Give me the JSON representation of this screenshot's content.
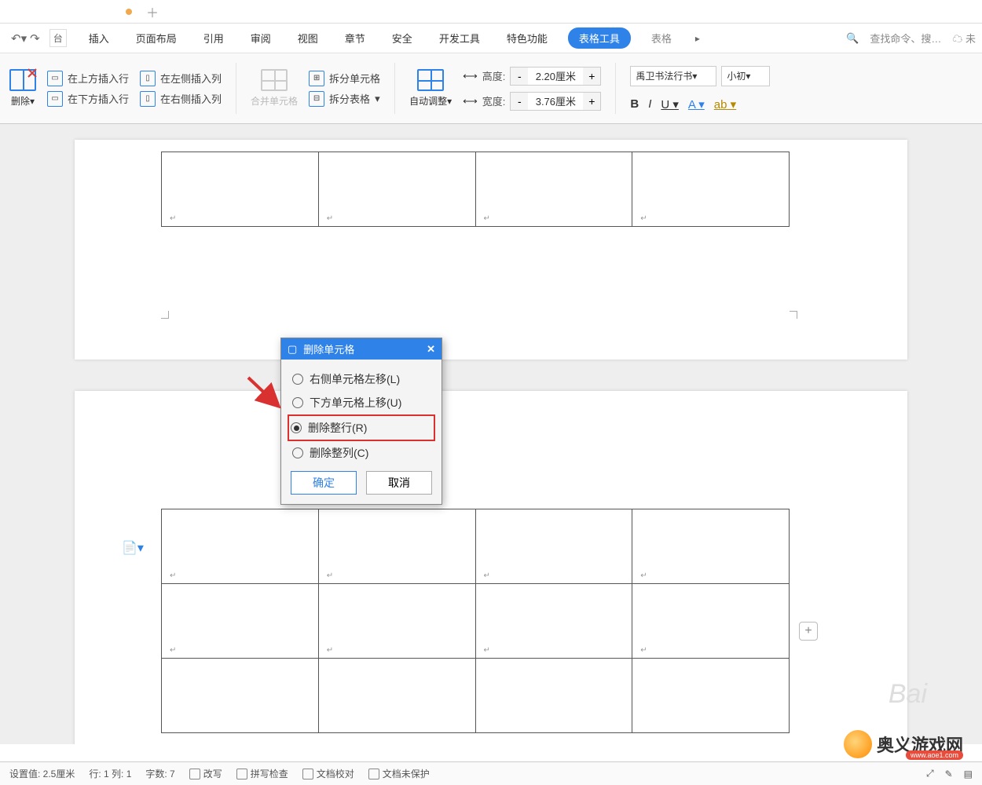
{
  "tabs_menu": {
    "trunc_left": "台",
    "items": [
      "插入",
      "页面布局",
      "引用",
      "审阅",
      "视图",
      "章节",
      "安全",
      "开发工具",
      "特色功能",
      "表格工具"
    ],
    "trunc_right": "表格",
    "active_index": 9,
    "search_placeholder": "查找命令、搜…",
    "cloud_suffix": "未"
  },
  "toolbar": {
    "delete": "删除",
    "insert_row_above": "在上方插入行",
    "insert_row_below": "在下方插入行",
    "insert_col_left": "在左侧插入列",
    "insert_col_right": "在右侧插入列",
    "merge_cells": "合并单元格",
    "split_cells": "拆分单元格",
    "split_table": "拆分表格",
    "autofit": "自动调整",
    "height_label": "高度:",
    "width_label": "宽度:",
    "height_value": "2.20厘米",
    "width_value": "3.76厘米",
    "font_name": "禹卫书法行书",
    "font_size": "小初"
  },
  "dialog": {
    "title": "删除单元格",
    "opt_shift_left": "右侧单元格左移(L)",
    "opt_shift_up": "下方单元格上移(U)",
    "opt_del_row": "删除整行(R)",
    "opt_del_col": "删除整列(C)",
    "ok": "确定",
    "cancel": "取消",
    "selected": "opt_del_row"
  },
  "status": {
    "set_value": "设置值: 2.5厘米",
    "rowcol": "行: 1  列: 1",
    "wordcount": "字数: 7",
    "overwrite": "改写",
    "spellcheck": "拼写检查",
    "doc_compare": "文档校对",
    "doc_unprotected": "文档未保护"
  },
  "footer_brand": {
    "name": "奥义游戏网",
    "url": "www.aoe1.com"
  },
  "watermark": "Bai"
}
